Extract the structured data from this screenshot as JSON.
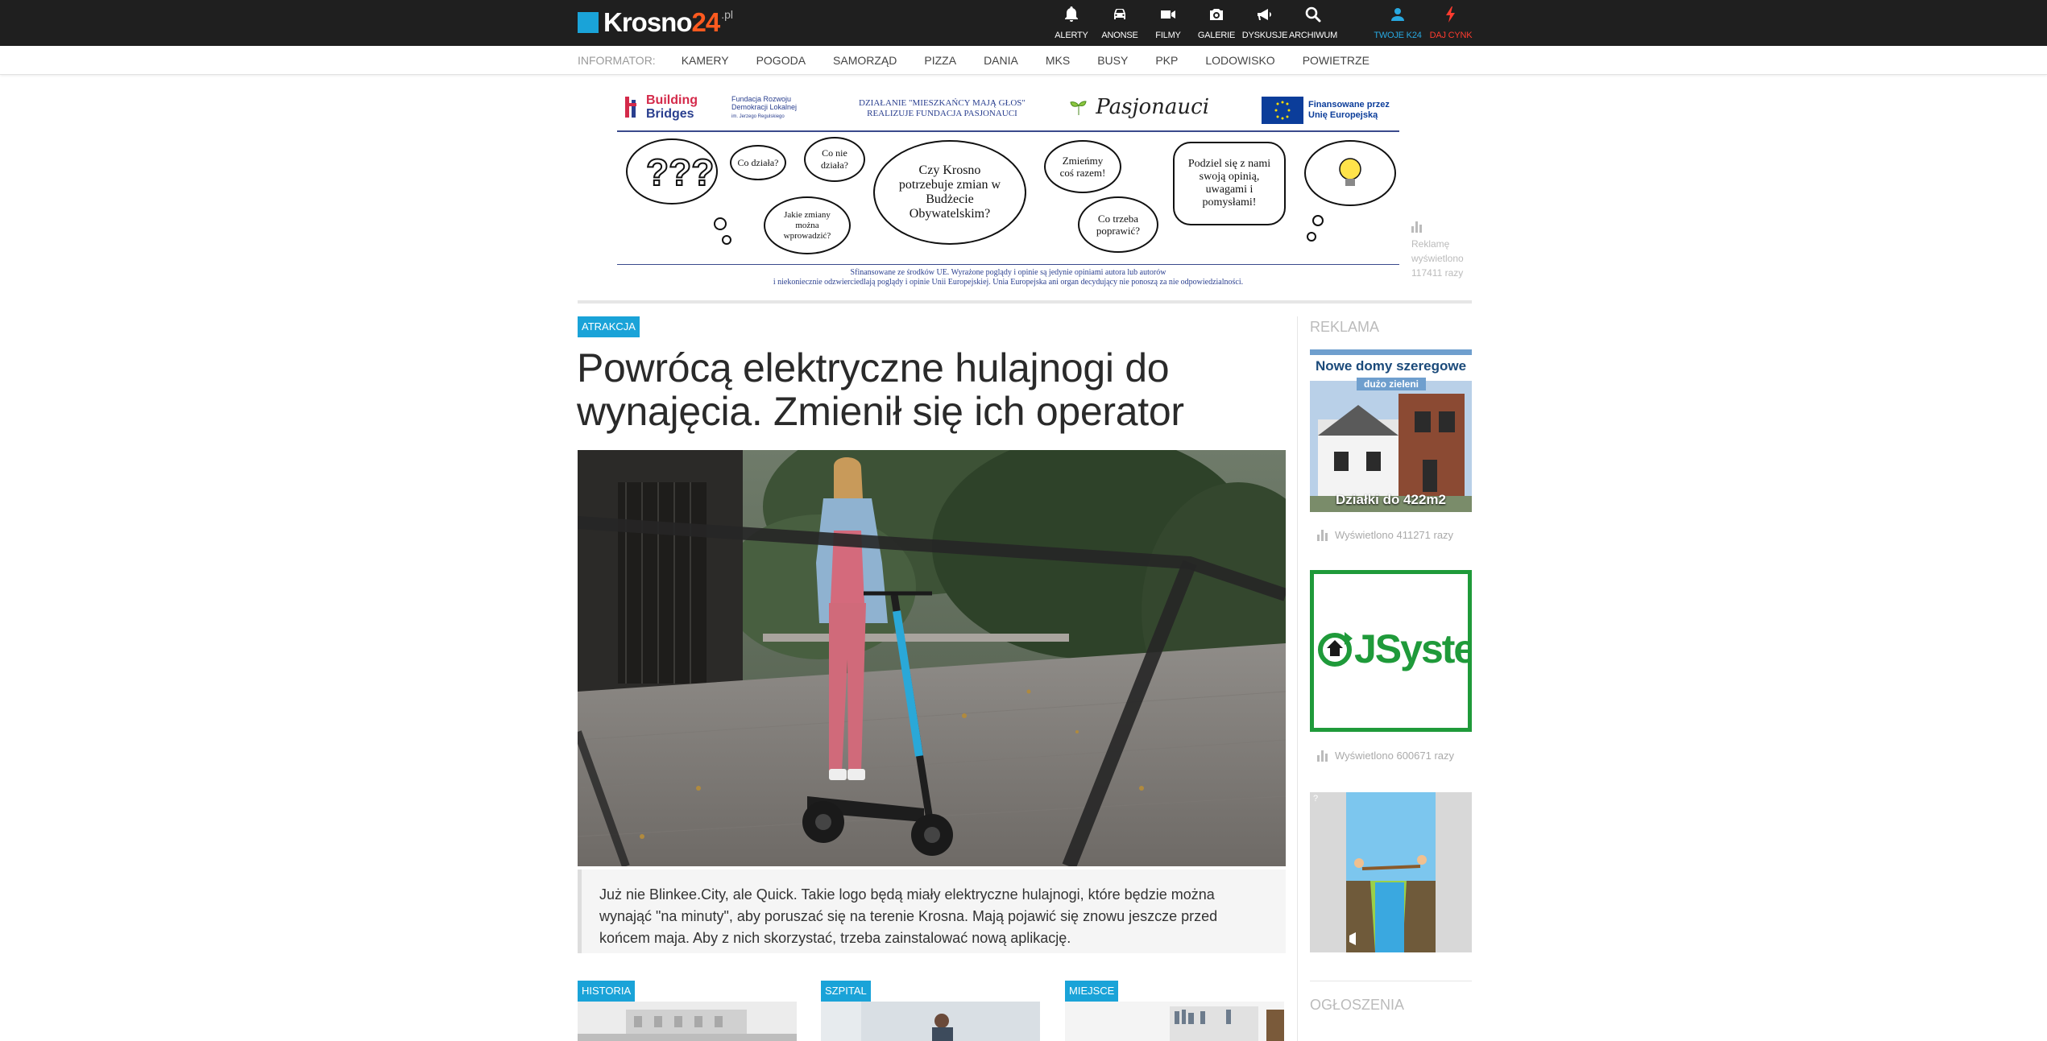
{
  "header": {
    "logo": {
      "name": "Krosno",
      "num": "24",
      "tld": ".pl"
    },
    "nav": [
      {
        "label": "ALERTY",
        "icon": "bell-icon"
      },
      {
        "label": "ANONSE",
        "icon": "car-icon"
      },
      {
        "label": "FILMY",
        "icon": "video-camera-icon"
      },
      {
        "label": "GALERIE",
        "icon": "photo-camera-icon"
      },
      {
        "label": "DYSKUSJE",
        "icon": "megaphone-icon"
      },
      {
        "label": "ARCHIWUM",
        "icon": "search-icon"
      }
    ],
    "nav_right": [
      {
        "label": "TWOJE K24",
        "icon": "user-icon",
        "color": "#28a8e0"
      },
      {
        "label": "DAJ CYNK",
        "icon": "lightning-icon",
        "color": "#ff3b2f"
      }
    ]
  },
  "informator": {
    "label": "INFORMATOR:",
    "items": [
      "KAMERY",
      "POGODA",
      "SAMORZĄD",
      "PIZZA",
      "DANIA",
      "MKS",
      "BUSY",
      "PKP",
      "LODOWISKO",
      "POWIETRZE"
    ]
  },
  "top_banner": {
    "bb_line1": "Building",
    "bb_line2": "Bridges",
    "fundacja": "Fundacja Rozwoju Demokracji Lokalnej",
    "fundacja_sub": "im. Jerzego Regulskiego",
    "center_line1": "DZIAŁANIE \"MIESZKAŃCY MAJĄ GŁOS\"",
    "center_line2": "REALIZUJE FUNDACJA PASJONAUCI",
    "pasjonauci": "Pasjonauci",
    "eu_line1": "Finansowane przez",
    "eu_line2": "Unię Europejską",
    "bubbles": {
      "b1": "Co działa?",
      "b2": "Co nie działa?",
      "b3": "Jakie zmiany można wprowadzić?",
      "b4": "Czy Krosno potrzebuje zmian w Budżecie Obywatelskim?",
      "b5": "Zmieńmy coś razem!",
      "b6": "Co trzeba poprawić?",
      "b7": "Podziel się z nami swoją opinią, uwagami i pomysłami!"
    },
    "footer_line1": "Sfinansowane ze środków UE. Wyrażone poglądy i opinie są jedynie opiniami autora lub autorów",
    "footer_line2": "i niekoniecznie odzwierciedlają poglądy i opinie Unii Europejskiej.  Unia Europejska ani organ decydujący nie ponoszą za nie odpowiedzialności.",
    "views_label": "Reklamę wyświetlono 117411 razy"
  },
  "article": {
    "tag": "ATRAKCJA",
    "title": "Powrócą elektryczne hulajnogi do wynajęcia. Zmienił się ich operator",
    "lead": "Już nie Blinkee.City, ale Quick. Takie logo będą miały elektryczne hulajnogi, które będzie można wynająć \"na minuty\", aby poruszać się na terenie Krosna. Mają pojawić się znowu jeszcze przed końcem maja. Aby z nich skorzystać, trzeba zainstalować nową aplikację."
  },
  "related": [
    {
      "tag": "HISTORIA"
    },
    {
      "tag": "SZPITAL"
    },
    {
      "tag": "MIEJSCE"
    }
  ],
  "sidebar": {
    "reklama_label": "REKLAMA",
    "ad1": {
      "title": "Nowe domy szeregowe",
      "pill": "dużo zieleni",
      "bottom": "Działki do 422m2",
      "views": "Wyświetlono 411271 razy"
    },
    "ad2": {
      "brand": "JSystem",
      "views": "Wyświetlono 600671 razy"
    },
    "ad3": {
      "badge": "?"
    },
    "ogloszenia_label": "OGŁOSZENIA"
  }
}
